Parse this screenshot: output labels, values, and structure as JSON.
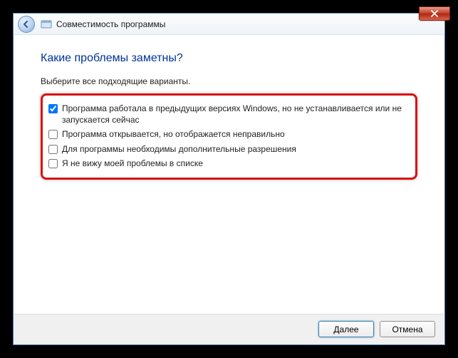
{
  "window": {
    "title": "Совместимость программы"
  },
  "page": {
    "heading": "Какие проблемы заметны?",
    "instruction": "Выберите все подходящие варианты."
  },
  "options": [
    {
      "label": "Программа работала в предыдущих версиях Windows, но не устанавливается или не запускается сейчас",
      "checked": true
    },
    {
      "label": "Программа открывается, но отображается неправильно",
      "checked": false
    },
    {
      "label": "Для программы необходимы дополнительные разрешения",
      "checked": false
    },
    {
      "label": "Я не вижу моей проблемы в списке",
      "checked": false
    }
  ],
  "buttons": {
    "next": "Далее",
    "cancel": "Отмена"
  }
}
